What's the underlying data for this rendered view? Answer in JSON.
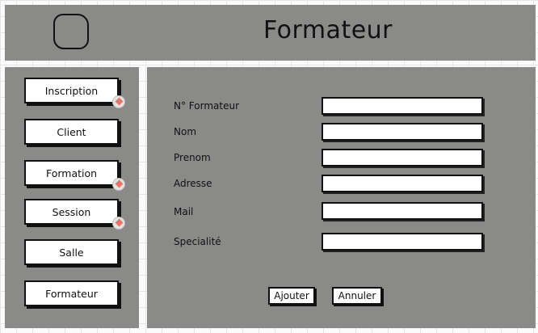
{
  "header": {
    "title": "Formateur",
    "logo_icon": "logo-placeholder"
  },
  "sidebar": {
    "items": [
      {
        "label": "Inscription",
        "has_link": true
      },
      {
        "label": "Client",
        "has_link": false
      },
      {
        "label": "Formation",
        "has_link": true
      },
      {
        "label": "Session",
        "has_link": true
      },
      {
        "label": "Salle",
        "has_link": false
      },
      {
        "label": "Formateur",
        "has_link": false
      }
    ]
  },
  "form": {
    "fields": [
      {
        "label": "N° Formateur",
        "value": ""
      },
      {
        "label": "Nom",
        "value": ""
      },
      {
        "label": "Prenom",
        "value": ""
      },
      {
        "label": "Adresse",
        "value": ""
      },
      {
        "label": "Mail",
        "value": ""
      },
      {
        "label": "Specialité",
        "value": ""
      }
    ],
    "submit_label": "Ajouter",
    "cancel_label": "Annuler"
  },
  "colors": {
    "panel": "#8a8a89",
    "link_icon": "#e2776a"
  }
}
